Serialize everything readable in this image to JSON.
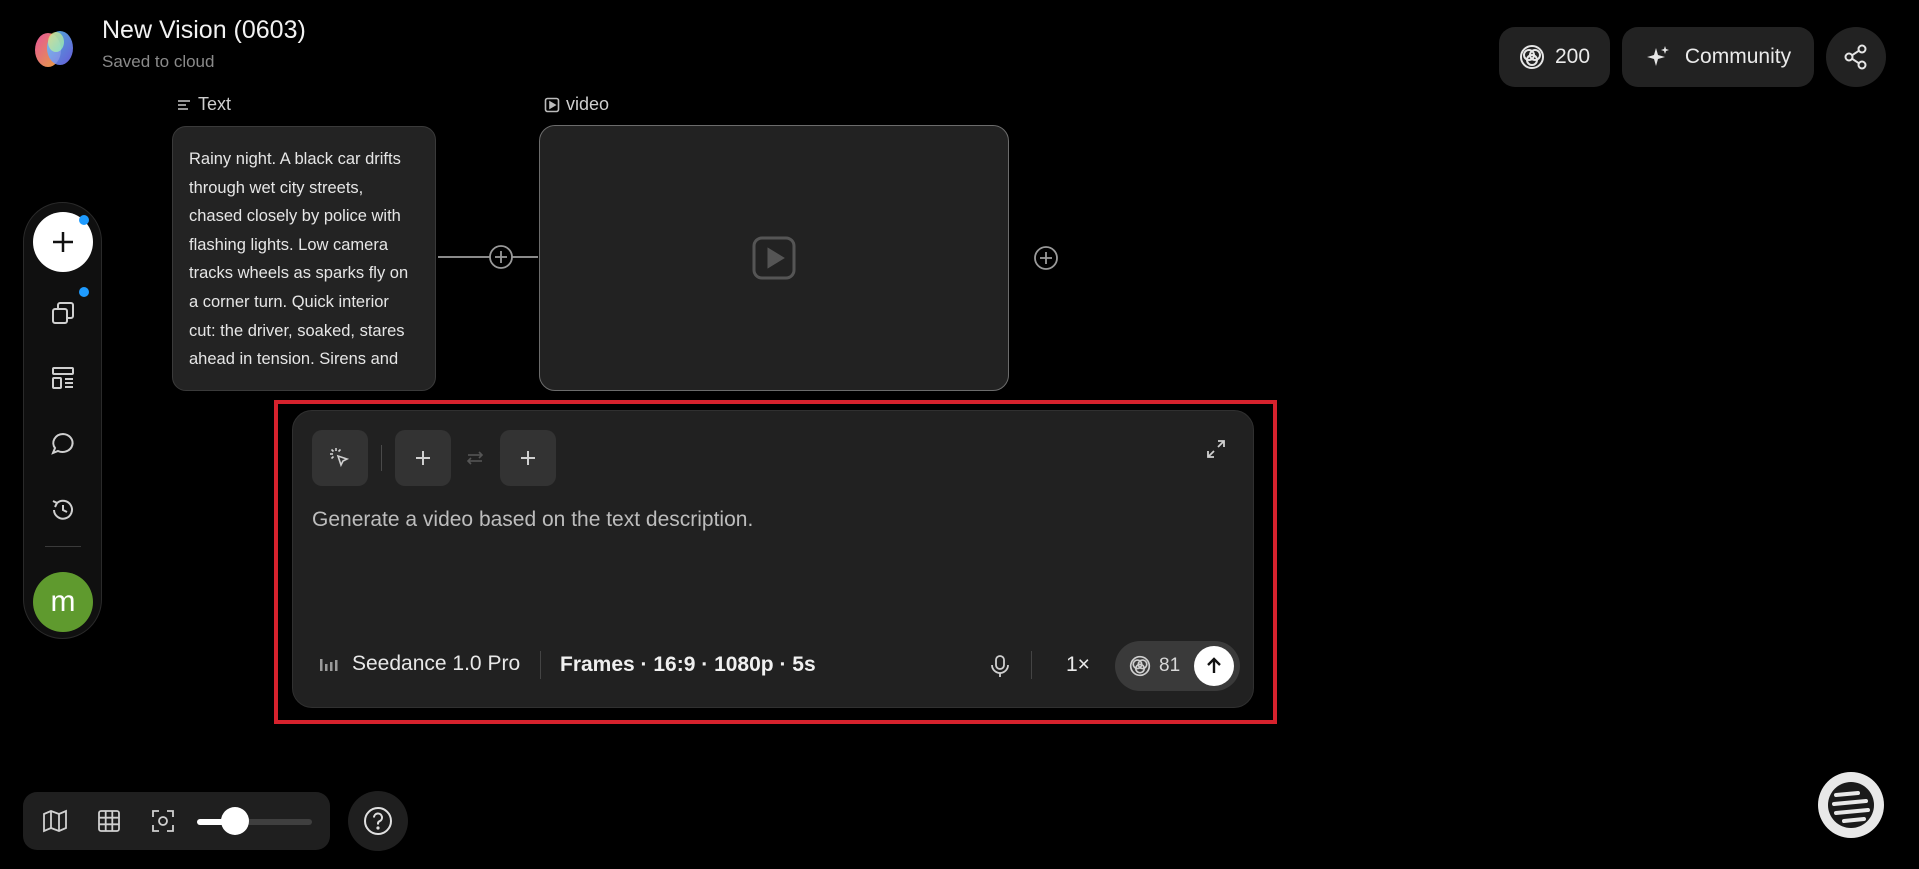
{
  "header": {
    "title": "New Vision (0603)",
    "subtitle": "Saved to cloud",
    "credits": "200",
    "community_label": "Community"
  },
  "sidebar": {
    "avatar_letter": "m"
  },
  "nodes": {
    "text_label": "Text",
    "text_content": "Rainy night. A black car drifts through wet city streets, chased closely by police with flashing lights. Low camera tracks wheels as sparks fly on a corner turn. Quick interior cut: the driver, soaked, stares ahead in tension. Sirens and",
    "video_label": "video"
  },
  "prompt_panel": {
    "prompt_text": "Generate a video based on the text description.",
    "model_name": "Seedance 1.0 Pro",
    "settings": "Frames · 16:9 · 1080p · 5s",
    "speed": "1×",
    "cost": "81"
  },
  "colors": {
    "highlight": "#d6222d",
    "notification_dot": "#1e9bff",
    "avatar_bg": "#5f9a2e"
  },
  "bottom": {
    "zoom_level": 0.2
  }
}
